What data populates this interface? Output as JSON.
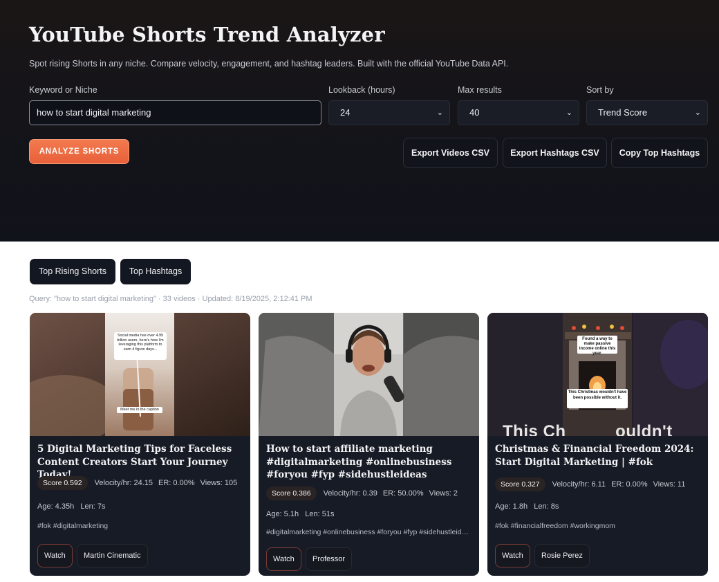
{
  "header": {
    "title": "YouTube Shorts Trend Analyzer",
    "subtitle": "Spot rising Shorts in any niche. Compare velocity, engagement, and hashtag leaders. Built with the official YouTube Data API."
  },
  "form": {
    "keyword_label": "Keyword or Niche",
    "keyword_value": "how to start digital marketing",
    "lookback_label": "Lookback (hours)",
    "lookback_value": "24",
    "max_label": "Max results",
    "max_value": "40",
    "sort_label": "Sort by",
    "sort_value": "Trend Score"
  },
  "actions": {
    "analyze": "ANALYZE SHORTS",
    "export_videos": "Export Videos CSV",
    "export_hashtags": "Export Hashtags CSV",
    "copy_hashtags": "Copy Top Hashtags"
  },
  "tabs": [
    "Top Rising Shorts",
    "Top Hashtags"
  ],
  "meta": "Query: \"how to start digital marketing\" · 33 videos · Updated: 8/19/2025, 2:12:41 PM",
  "cards": [
    {
      "title": "5 Digital Marketing Tips for Faceless Content Creators Start Your Journey Today!",
      "score": "Score 0.592",
      "velocity": "Velocity/hr: 24.15",
      "er": "ER: 0.00%",
      "views": "Views: 105",
      "age": "Age: 4.35h",
      "len": "Len: 7s",
      "tags": "#fok #digitalmarketing",
      "watch": "Watch",
      "author": "Martin Cinematic",
      "thumb_text_top": "Social media has over 4.95 billion users, here's how I'm leveraging this platform to earn 4 figure days...",
      "thumb_text_bottom": "Meet me in the caption"
    },
    {
      "title": "How to start affiliate marketing #digitalmarketing #onlinebusiness #foryou #fyp #sidehustleideas",
      "score": "Score 0.386",
      "velocity": "Velocity/hr: 0.39",
      "er": "ER: 50.00%",
      "views": "Views: 2",
      "age": "Age: 5.1h",
      "len": "Len: 51s",
      "tags": "#digitalmarketing #onlinebusiness #foryou #fyp #sidehustleideas",
      "watch": "Watch",
      "author": "Professor"
    },
    {
      "title": "Christmas & Financial Freedom 2024: Start Digital Marketing | #fok",
      "score": "Score 0.327",
      "velocity": "Velocity/hr: 6.11",
      "er": "ER: 0.00%",
      "views": "Views: 11",
      "age": "Age: 1.8h",
      "len": "Len: 8s",
      "tags": "#fok #financialfreedom #workingmom",
      "watch": "Watch",
      "author": "Rosie Perez",
      "thumb_text_top": "Found a way to make passive income online this year.",
      "thumb_text_mid": "This Christmas wouldn't have been possible without it.",
      "thumb_text_big": "This Ch          ouldn't"
    }
  ],
  "colors": {
    "accent": "#f06e45",
    "hero_bg": "#13151c",
    "card_bg": "#171b25"
  }
}
